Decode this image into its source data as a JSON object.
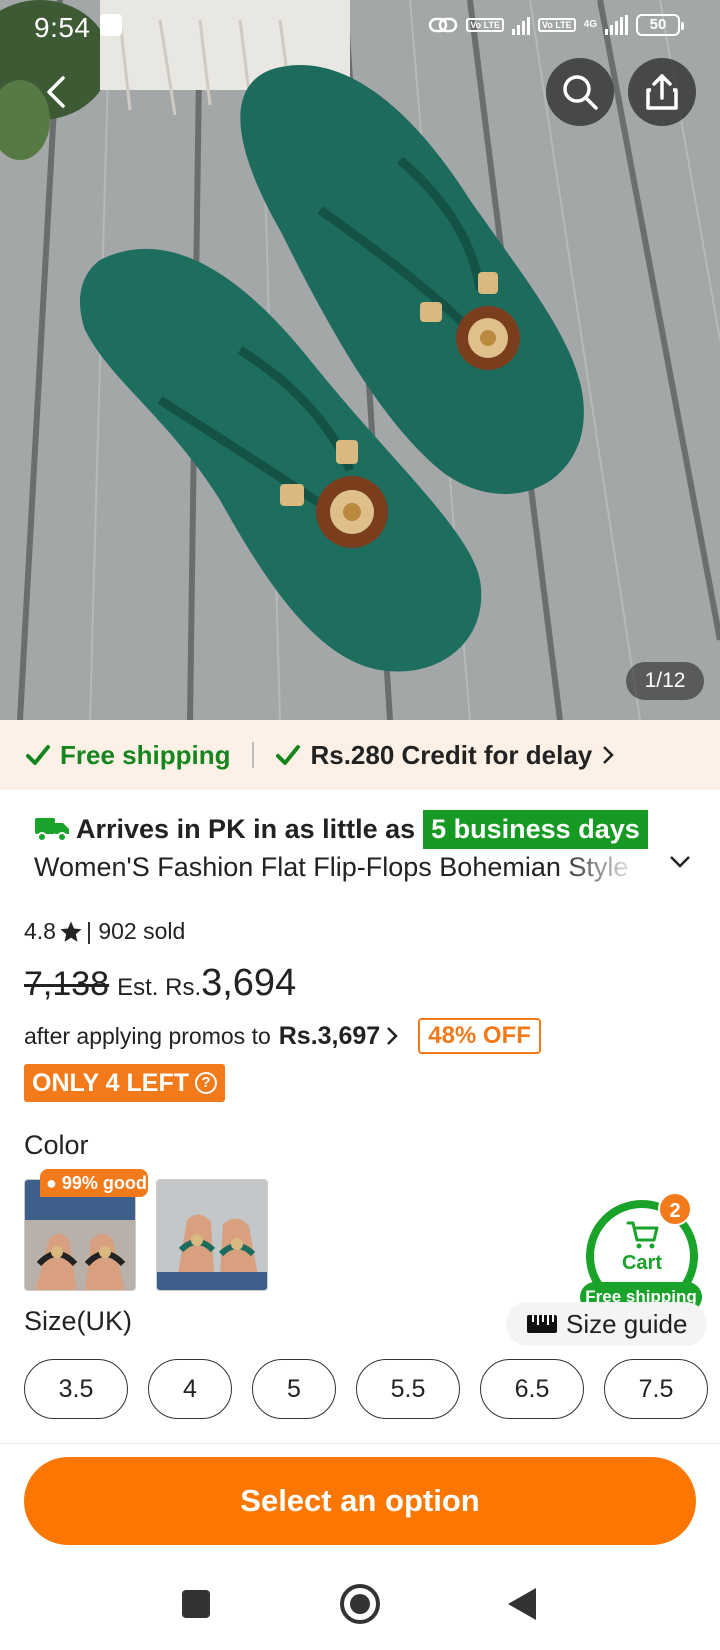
{
  "status_bar": {
    "time": "9:54",
    "network_label": "4G",
    "volte_1": "Vo LTE",
    "volte_2": "Vo LTE",
    "battery": "50"
  },
  "product_image": {
    "counter": "1/12",
    "icons": [
      "back-arrow-icon",
      "search-icon",
      "share-icon"
    ]
  },
  "shipping": {
    "free_shipping": "Free shipping",
    "credit": "Rs.280 Credit for delay",
    "accent_color": "#15861e"
  },
  "arrival": {
    "text": "Arrives in PK in as little as",
    "badge": "5 business days"
  },
  "product": {
    "title": "Women'S Fashion Flat Flip-Flops Bohemian Style",
    "rating": "4.8",
    "sold": "| 902 sold"
  },
  "price": {
    "original": "7,138",
    "est_label": "Est. Rs.",
    "current": "3,694",
    "promo_text": "after applying promos to",
    "promo_price": "Rs.3,697",
    "discount": "48% OFF",
    "stock": "ONLY 4 LEFT"
  },
  "color": {
    "label": "Color",
    "hot_badge": "99% good",
    "options": [
      "black",
      "green"
    ]
  },
  "cart": {
    "label": "Cart",
    "count": "2",
    "free_shipping": "Free shipping"
  },
  "size": {
    "label": "Size(UK)",
    "guide": "Size guide",
    "options": [
      "3.5",
      "4",
      "5",
      "5.5",
      "6.5",
      "7.5"
    ]
  },
  "cta": {
    "label": "Select an option",
    "color": "#fb7701"
  }
}
